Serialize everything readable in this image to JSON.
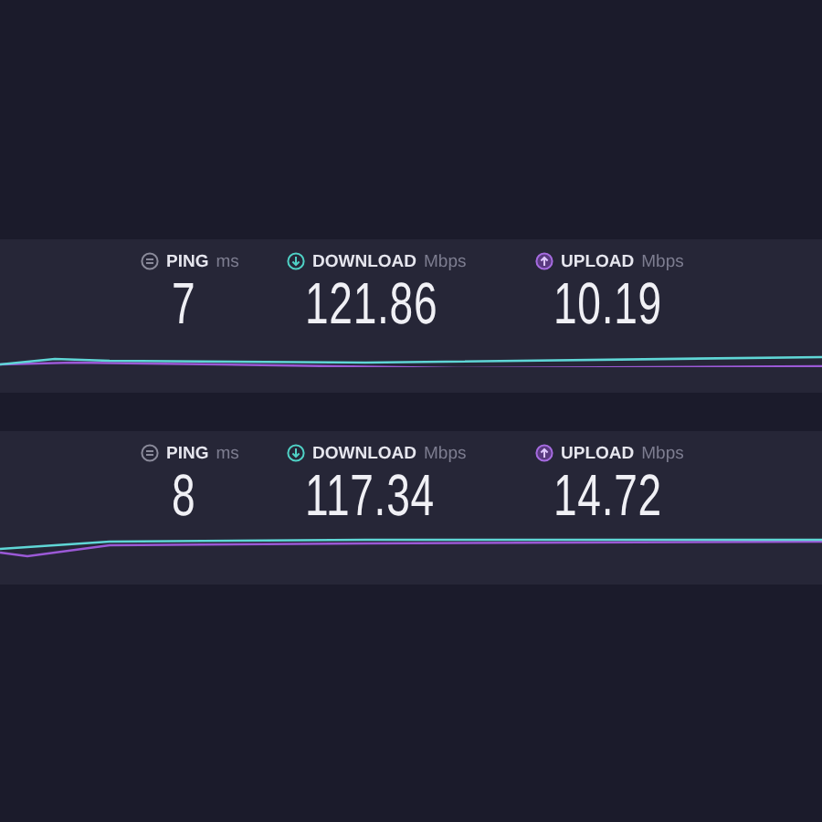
{
  "results": [
    {
      "metrics": [
        {
          "kind": "ping",
          "label": "PING",
          "unit": "ms",
          "value": "7"
        },
        {
          "kind": "download",
          "label": "DOWNLOAD",
          "unit": "Mbps",
          "value": "121.86"
        },
        {
          "kind": "upload",
          "label": "UPLOAD",
          "unit": "Mbps",
          "value": "10.19"
        }
      ]
    },
    {
      "metrics": [
        {
          "kind": "ping",
          "label": "PING",
          "unit": "ms",
          "value": "8"
        },
        {
          "kind": "download",
          "label": "DOWNLOAD",
          "unit": "Mbps",
          "value": "117.34"
        },
        {
          "kind": "upload",
          "label": "UPLOAD",
          "unit": "Mbps",
          "value": "14.72"
        }
      ]
    }
  ]
}
